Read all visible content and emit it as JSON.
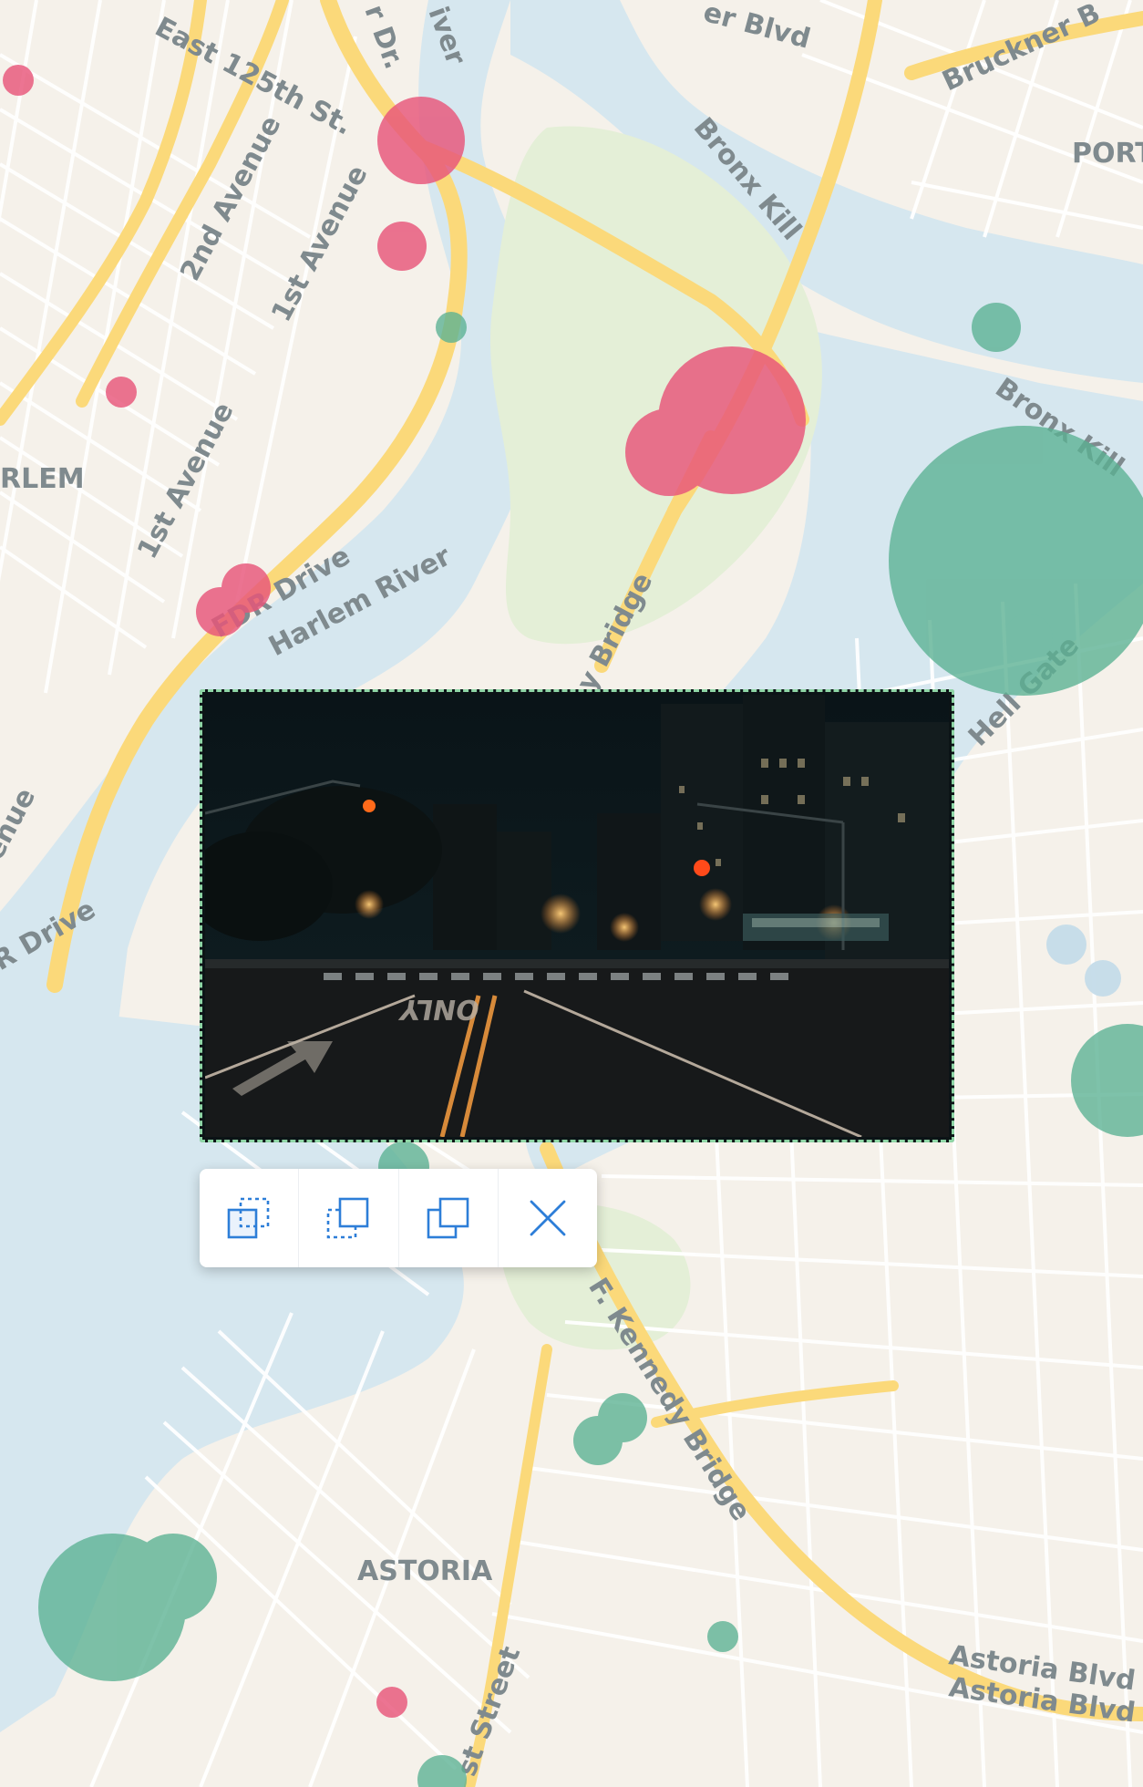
{
  "map": {
    "labels": {
      "east_125th": "East 125th St.",
      "second_ave": "2nd Avenue",
      "first_ave_top": "1st Avenue",
      "first_ave_mid": "1st Avenue",
      "harlem": "RLEM",
      "fdr_drive_top": "FDR Drive",
      "harlem_river": "Harlem River",
      "bruckner_blvd": "Bruckner B",
      "blvd_top": "er Blvd",
      "river_top": "iver",
      "dr_top": "r Dr.",
      "bronx_kill_top": "Bronx Kill",
      "bronx_kill_right": "Bronx Kill",
      "port": "PORT",
      "hell_gate": "Hell Gate",
      "bridge_mid": "y Bridge",
      "avenue_left": "enue",
      "drive_left": "R Drive",
      "rfk_bridge": "F. Kennedy Bridge",
      "astoria": "ASTORIA",
      "astoria_blvd_1": "Astoria Blvd",
      "astoria_blvd_2": "Astoria Blvd",
      "street_bottom": "st Street"
    },
    "colors": {
      "land": "#f5f1ea",
      "water": "#d6e7ef",
      "park": "#e4efd7",
      "major_road": "#fbd97a",
      "minor_road": "#ffffff",
      "label": "#7f8a8e",
      "pink_bubble": "#e8557a",
      "green_bubble": "#5ab192",
      "blue_bubble": "#c5dce9"
    }
  },
  "photo": {
    "road_marking": "ONLY"
  },
  "toolbar": {
    "buttons": [
      {
        "icon": "send-to-back-icon"
      },
      {
        "icon": "send-backward-icon"
      },
      {
        "icon": "bring-forward-icon"
      },
      {
        "icon": "close-icon"
      }
    ],
    "accent": "#2d7ed8"
  }
}
